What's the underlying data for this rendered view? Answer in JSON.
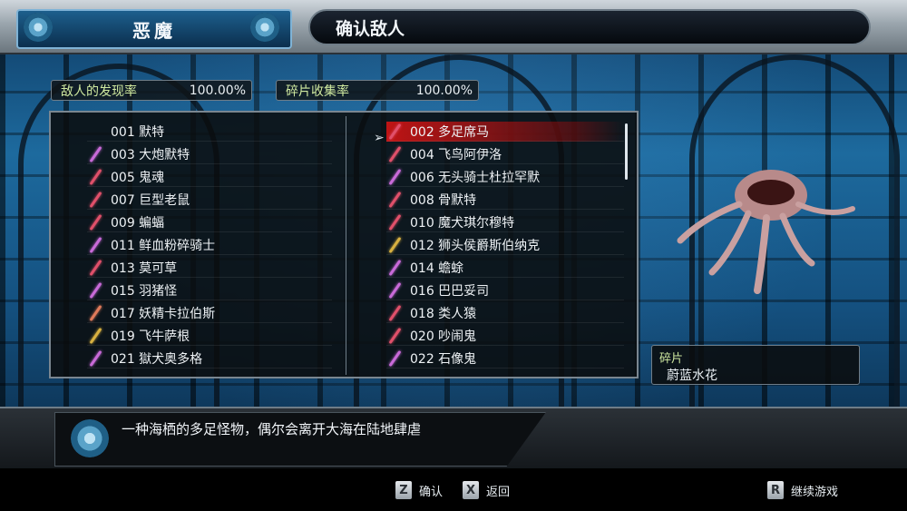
{
  "header": {
    "left_title": "恶魔",
    "right_title": "确认敌人"
  },
  "stats": {
    "discovery_label": "敌人的发现率",
    "discovery_value": "100.00%",
    "shard_label": "碎片收集率",
    "shard_value": "100.00%"
  },
  "list": {
    "left": [
      {
        "label": "001 默特",
        "gem": ""
      },
      {
        "label": "003 大炮默特",
        "gem": "#c86ad8"
      },
      {
        "label": "005 鬼魂",
        "gem": "#e0506a"
      },
      {
        "label": "007 巨型老鼠",
        "gem": "#e0506a"
      },
      {
        "label": "009 蝙蝠",
        "gem": "#e0506a"
      },
      {
        "label": "011 鲜血粉碎骑士",
        "gem": "#c86ad8"
      },
      {
        "label": "013 莫可草",
        "gem": "#e0506a"
      },
      {
        "label": "015 羽猪怪",
        "gem": "#c86ad8"
      },
      {
        "label": "017 妖精卡拉伯斯",
        "gem": "#e07a5a"
      },
      {
        "label": "019 飞牛萨根",
        "gem": "#d8b040"
      },
      {
        "label": "021 獄犬奥多格",
        "gem": "#c86ad8"
      }
    ],
    "right": [
      {
        "label": "002 多足席马",
        "gem": "#e0506a"
      },
      {
        "label": "004 飞鸟阿伊洛",
        "gem": "#e0506a"
      },
      {
        "label": "006 无头骑士杜拉罕默",
        "gem": "#c86ad8"
      },
      {
        "label": "008 骨默特",
        "gem": "#e0506a"
      },
      {
        "label": "010 魔犬琪尔穆特",
        "gem": "#e0506a"
      },
      {
        "label": "012 狮头侯爵斯伯纳克",
        "gem": "#d8b040"
      },
      {
        "label": "014 蟾蜍",
        "gem": "#c86ad8"
      },
      {
        "label": "016 巴巴妥司",
        "gem": "#c86ad8"
      },
      {
        "label": "018 类人猿",
        "gem": "#e0506a"
      },
      {
        "label": "020 吵闹鬼",
        "gem": "#e0506a"
      },
      {
        "label": "022 石像鬼",
        "gem": "#c86ad8"
      }
    ],
    "selected_side": "right",
    "selected_index": 0
  },
  "shard_panel": {
    "title": "碎片",
    "value": "蔚蓝水花"
  },
  "description": {
    "text": "一种海栖的多足怪物，偶尔会离开大海在陆地肆虐"
  },
  "controls": {
    "confirm_key": "Z",
    "confirm_label": "确认",
    "back_key": "X",
    "back_label": "返回",
    "continue_key": "R",
    "continue_label": "继续游戏"
  },
  "colors": {
    "selection": "#c81414",
    "accent_blue": "#1d5f8d",
    "stat_label": "#cfe9a0",
    "shard_label": "#cfe9a0"
  }
}
